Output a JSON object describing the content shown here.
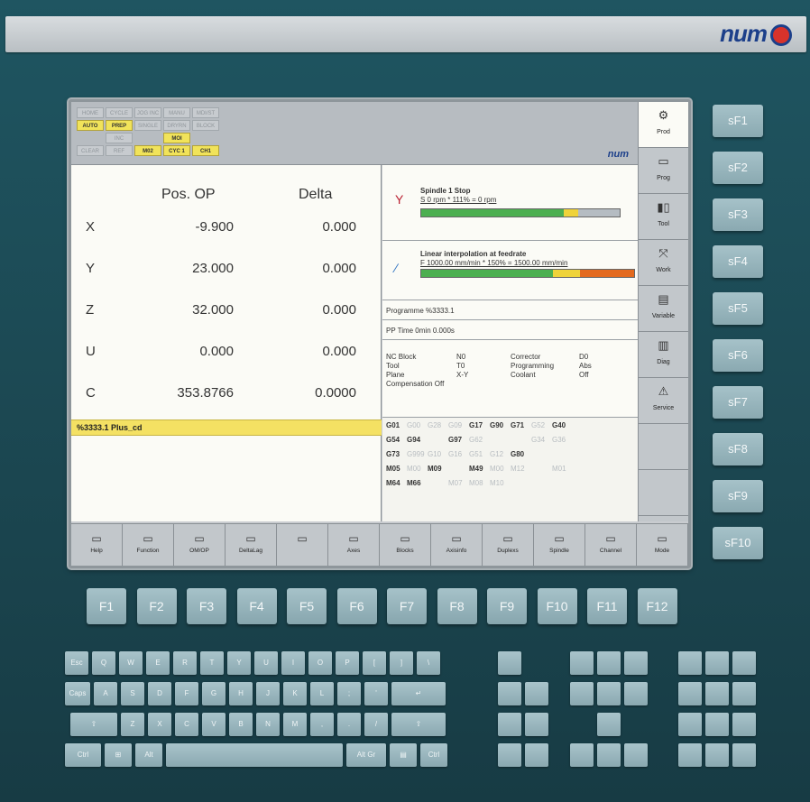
{
  "brand": "num",
  "modes": {
    "row1": [
      "HOME",
      "CYCLE",
      "JOG INC",
      "MANU",
      "MDI/ST"
    ],
    "row2": [
      "AUTO",
      "PREP",
      "SINGLE",
      "DRYRN",
      "BLOCK"
    ],
    "row3": [
      "",
      "INC",
      "",
      "MOI",
      ""
    ],
    "row4": [
      "CLEAR",
      "REF",
      "M02",
      "CYC 1",
      "CH1"
    ],
    "active": [
      "AUTO",
      "PREP",
      "MOI",
      "M02",
      "CYC 1",
      "CH1"
    ]
  },
  "header_logo": "num",
  "positions": {
    "col_pos": "Pos. OP",
    "col_delta": "Delta",
    "rows": [
      {
        "axis": "X",
        "pos": "-9.900",
        "delta": "0.000"
      },
      {
        "axis": "Y",
        "pos": "23.000",
        "delta": "0.000"
      },
      {
        "axis": "Z",
        "pos": "32.000",
        "delta": "0.000"
      },
      {
        "axis": "U",
        "pos": "0.000",
        "delta": "0.000"
      },
      {
        "axis": "C",
        "pos": "353.8766",
        "delta": "0.0000"
      }
    ]
  },
  "program_line": "%3333.1 Plus_cd",
  "spindle": {
    "title": "Spindle 1 Stop",
    "detail": "S 0 rpm * 111% = 0 rpm",
    "fill": 0.78,
    "color": "#4caf50"
  },
  "feed": {
    "title": "Linear interpolation at feedrate",
    "detail": "F 1000.00 mm/min * 150% = 1500.00 mm/min",
    "fill": 0.62,
    "color": "#4caf50"
  },
  "programme": "Programme %3333.1",
  "pp_time": "PP Time 0min 0.000s",
  "block": {
    "labels": [
      "NC Block",
      "Tool",
      "Plane",
      "Compensation Off"
    ],
    "values": [
      "N0",
      "T0",
      "X-Y",
      ""
    ],
    "labels2": [
      "Corrector",
      "Programming",
      "Coolant"
    ],
    "values2": [
      "D0",
      "Abs",
      "Off"
    ]
  },
  "gcodes": [
    [
      {
        "t": "G01",
        "on": 1
      },
      {
        "t": "G00",
        "on": 0
      },
      {
        "t": "G28",
        "on": 0
      },
      {
        "t": "G09",
        "on": 0
      },
      {
        "t": "G17",
        "on": 1
      },
      {
        "t": "G90",
        "on": 1
      },
      {
        "t": "G71",
        "on": 1
      },
      {
        "t": "G52",
        "on": 0
      },
      {
        "t": "G40",
        "on": 1
      }
    ],
    [
      {
        "t": "G54",
        "on": 1
      },
      {
        "t": "G94",
        "on": 1
      },
      {
        "t": "",
        "on": 0
      },
      {
        "t": "G97",
        "on": 1
      },
      {
        "t": "G62",
        "on": 0
      },
      {
        "t": "",
        "on": 0
      },
      {
        "t": "",
        "on": 0
      },
      {
        "t": "G34",
        "on": 0
      },
      {
        "t": "G36",
        "on": 0
      }
    ],
    [
      {
        "t": "G73",
        "on": 1
      },
      {
        "t": "G999",
        "on": 0
      },
      {
        "t": "G10",
        "on": 0
      },
      {
        "t": "G16",
        "on": 0
      },
      {
        "t": "G51",
        "on": 0
      },
      {
        "t": "G12",
        "on": 0
      },
      {
        "t": "G80",
        "on": 1
      },
      {
        "t": "",
        "on": 0
      },
      {
        "t": "",
        "on": 0
      }
    ],
    [
      {
        "t": "M05",
        "on": 1
      },
      {
        "t": "M00",
        "on": 0
      },
      {
        "t": "M09",
        "on": 1
      },
      {
        "t": "",
        "on": 0
      },
      {
        "t": "M49",
        "on": 1
      },
      {
        "t": "M00",
        "on": 0
      },
      {
        "t": "M12",
        "on": 0
      },
      {
        "t": "",
        "on": 0
      },
      {
        "t": "M01",
        "on": 0
      }
    ],
    [
      {
        "t": "M64",
        "on": 1
      },
      {
        "t": "M66",
        "on": 1
      },
      {
        "t": "",
        "on": 0
      },
      {
        "t": "M07",
        "on": 0
      },
      {
        "t": "M08",
        "on": 0
      },
      {
        "t": "M10",
        "on": 0
      },
      {
        "t": "",
        "on": 0
      },
      {
        "t": "",
        "on": 0
      },
      {
        "t": "",
        "on": 0
      }
    ]
  ],
  "vside": [
    "Prod",
    "Prog",
    "Tool",
    "Work",
    "Variable",
    "Diag",
    "Service",
    "",
    ""
  ],
  "hbar": [
    "Help",
    "Function",
    "OM/OP",
    "DeltaLag",
    "",
    "Axes",
    "Blocks",
    "Axisinfo",
    "Duplexs",
    "Spindle",
    "Channel",
    "Mode"
  ],
  "sf_keys": [
    "sF1",
    "sF2",
    "sF3",
    "sF4",
    "sF5",
    "sF6",
    "sF7",
    "sF8",
    "sF9",
    "sF10"
  ],
  "f_keys": [
    "F1",
    "F2",
    "F3",
    "F4",
    "F5",
    "F6",
    "F7",
    "F8",
    "F9",
    "F10",
    "F11",
    "F12"
  ],
  "keyboard": {
    "row1": [
      "Esc",
      "Q",
      "W",
      "E",
      "R",
      "T",
      "Y",
      "U",
      "I",
      "O",
      "P",
      "[",
      "]",
      "\\"
    ],
    "row2": [
      "Caps Lock",
      "A",
      "S",
      "D",
      "F",
      "G",
      "H",
      "J",
      "K",
      "L",
      ";",
      "'",
      "↵"
    ],
    "row3": [
      "⇧",
      "Z",
      "X",
      "C",
      "V",
      "B",
      "N",
      "M",
      ",",
      ".",
      "/",
      "⇧"
    ],
    "row4": [
      "Ctrl",
      "⊞",
      "Alt",
      "",
      "Alt Gr",
      "▤",
      "Ctrl"
    ]
  }
}
